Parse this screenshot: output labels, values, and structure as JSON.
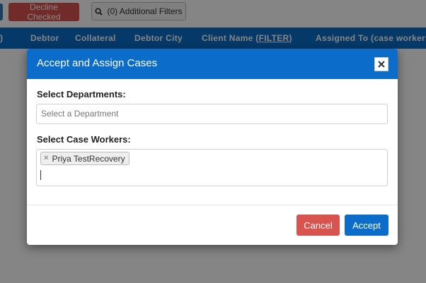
{
  "toolbar": {
    "decline_label": "Decline Checked",
    "filters_label": "(0) Additional Filters"
  },
  "table": {
    "headers": [
      {
        "label": ")"
      },
      {
        "label": "Debtor"
      },
      {
        "label": "Collateral"
      },
      {
        "label": "Debtor City"
      },
      {
        "label": "Client Name (",
        "link": "FILTER",
        "suffix": ")"
      },
      {
        "label": "Assigned To (case workers"
      }
    ]
  },
  "modal": {
    "title": "Accept and Assign Cases",
    "departments_label": "Select Departments:",
    "departments_placeholder": "Select a Department",
    "workers_label": "Select Case Workers:",
    "selected_workers": [
      "Priya TestRecovery"
    ],
    "cancel_label": "Cancel",
    "accept_label": "Accept"
  },
  "icons": {
    "search": "search-icon",
    "close": "close-icon",
    "remove": "remove-tag-icon"
  },
  "colors": {
    "primary": "#0b6dc9",
    "danger": "#d9534f"
  }
}
